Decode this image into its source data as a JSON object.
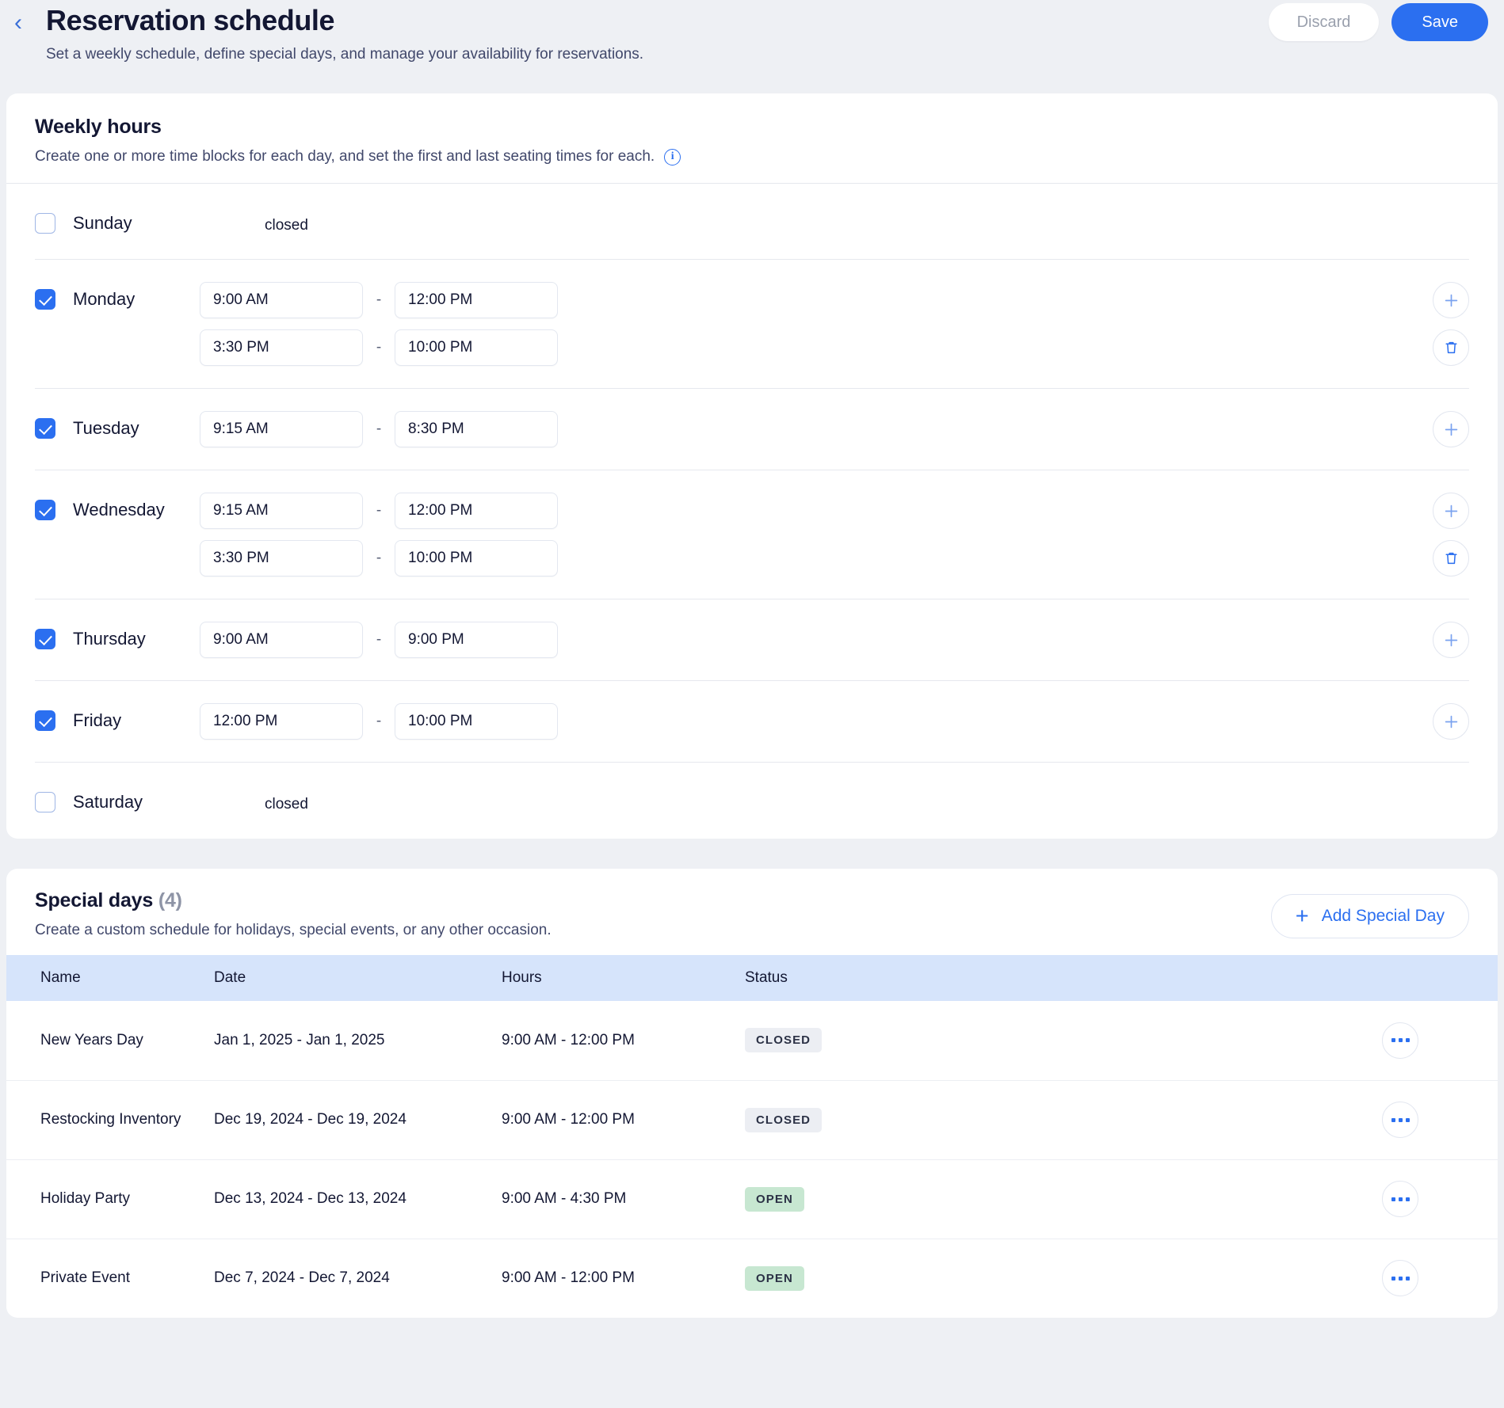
{
  "header": {
    "back_icon": "chevron-left-icon",
    "title": "Reservation schedule",
    "subtitle": "Set a weekly schedule, define special days, and manage your availability for reservations.",
    "discard_label": "Discard",
    "save_label": "Save"
  },
  "weekly": {
    "title": "Weekly hours",
    "description": "Create one or more time blocks for each day, and set the first and last seating times for each.",
    "info_icon": "info-icon",
    "dash": "-",
    "closed_label": "closed",
    "days": [
      {
        "name": "Sunday",
        "checked": false,
        "closed": true,
        "blocks": []
      },
      {
        "name": "Monday",
        "checked": true,
        "closed": false,
        "blocks": [
          {
            "start": "9:00 AM",
            "end": "12:00 PM"
          },
          {
            "start": "3:30 PM",
            "end": "10:00 PM"
          }
        ]
      },
      {
        "name": "Tuesday",
        "checked": true,
        "closed": false,
        "blocks": [
          {
            "start": "9:15 AM",
            "end": "8:30 PM"
          }
        ]
      },
      {
        "name": "Wednesday",
        "checked": true,
        "closed": false,
        "blocks": [
          {
            "start": "9:15 AM",
            "end": "12:00 PM"
          },
          {
            "start": "3:30 PM",
            "end": "10:00 PM"
          }
        ]
      },
      {
        "name": "Thursday",
        "checked": true,
        "closed": false,
        "blocks": [
          {
            "start": "9:00 AM",
            "end": "9:00 PM"
          }
        ]
      },
      {
        "name": "Friday",
        "checked": true,
        "closed": false,
        "blocks": [
          {
            "start": "12:00 PM",
            "end": "10:00 PM"
          }
        ]
      },
      {
        "name": "Saturday",
        "checked": false,
        "closed": true,
        "blocks": []
      }
    ]
  },
  "special_days": {
    "title": "Special days",
    "count": "(4)",
    "description": "Create a custom schedule for holidays, special events, or any other occasion.",
    "add_button_label": "Add Special Day",
    "add_button_icon": "plus-icon",
    "columns": [
      "Name",
      "Date",
      "Hours",
      "Status"
    ],
    "rows": [
      {
        "name": "New Years Day",
        "date": "Jan 1, 2025 - Jan 1, 2025",
        "hours": "9:00 AM - 12:00 PM",
        "status": "CLOSED",
        "status_kind": "closed"
      },
      {
        "name": "Restocking Inventory",
        "date": "Dec 19, 2024 - Dec 19, 2024",
        "hours": "9:00 AM - 12:00 PM",
        "status": "CLOSED",
        "status_kind": "closed"
      },
      {
        "name": "Holiday Party",
        "date": "Dec 13, 2024 - Dec 13, 2024",
        "hours": "9:00 AM - 4:30 PM",
        "status": "OPEN",
        "status_kind": "open"
      },
      {
        "name": "Private Event",
        "date": "Dec 7, 2024 - Dec 7, 2024",
        "hours": "9:00 AM - 12:00 PM",
        "status": "OPEN",
        "status_kind": "open"
      }
    ]
  },
  "colors": {
    "accent": "#2b6ff0",
    "page_bg": "#eef0f4",
    "table_header_bg": "#d6e4fb",
    "badge_open_bg": "#c7e7d1",
    "badge_closed_bg": "#eceef3",
    "text_primary": "#131733",
    "text_muted": "#41486b"
  }
}
